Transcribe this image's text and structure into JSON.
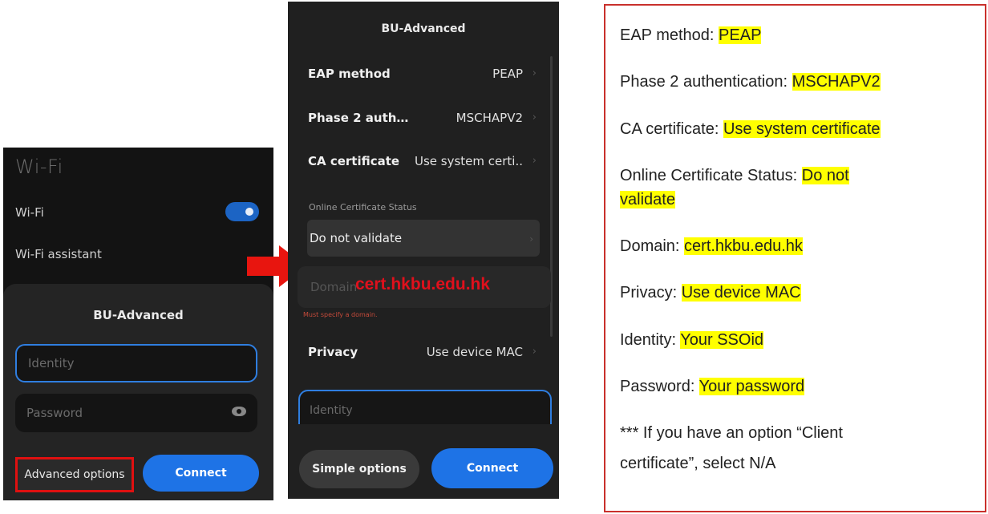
{
  "phone1": {
    "title": "Wi-Fi",
    "wifi_label": "Wi-Fi",
    "wifi_assistant_label": "Wi-Fi assistant",
    "sheet_title": "BU-Advanced",
    "identity_placeholder": "Identity",
    "password_placeholder": "Password",
    "advanced_button": "Advanced options",
    "connect_button": "Connect"
  },
  "phone2": {
    "title": "BU-Advanced",
    "eap_label": "EAP method",
    "eap_value": "PEAP",
    "phase2_label": "Phase 2 auth…",
    "phase2_value": "MSCHAPV2",
    "ca_label": "CA certificate",
    "ca_value": "Use system certi..",
    "ocs_label": "Online Certificate Status",
    "ocs_value": "Do not validate",
    "domain_placeholder": "Domain",
    "domain_value": "cert.hkbu.edu.hk",
    "domain_error": "Must specify a domain.",
    "privacy_label": "Privacy",
    "privacy_value": "Use device MAC",
    "identity_placeholder": "Identity",
    "simple_button": "Simple options",
    "connect_button": "Connect"
  },
  "info": {
    "eap_label": "EAP method: ",
    "eap_value": "PEAP",
    "phase2_label": "Phase 2 authentication: ",
    "phase2_value": "MSCHAPV2",
    "ca_label": "CA certificate: ",
    "ca_value": "Use system certificate",
    "ocs_label": "Online Certificate Status: ",
    "ocs_value_1": "Do not",
    "ocs_value_2": "validate",
    "domain_label": "Domain: ",
    "domain_value": "cert.hkbu.edu.hk",
    "privacy_label": "Privacy: ",
    "privacy_value": "Use device MAC",
    "identity_label": "Identity: ",
    "identity_value": "Your SSOid",
    "password_label": "Password: ",
    "password_value": "Your password",
    "note_line1": "*** If you have an option “Client",
    "note_line2": "certificate”, select N/A"
  },
  "colors": {
    "accent_blue": "#1e73e6",
    "highlight_red": "#e01010",
    "highlight_yellow": "#ffff00",
    "border_red": "#c9302c"
  }
}
